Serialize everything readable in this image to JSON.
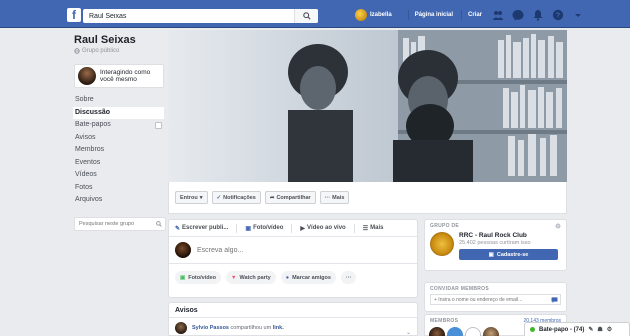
{
  "topbar": {
    "logo": "f",
    "search_value": "Raul Seixas",
    "user_name": "Izabella",
    "home_label": "Página inicial",
    "create_label": "Criar"
  },
  "group": {
    "name": "Raul Seixas",
    "type": "Grupo público",
    "interact_label": "Interagindo como você mesmo"
  },
  "sidebar": {
    "items": [
      {
        "label": "Sobre"
      },
      {
        "label": "Discussão"
      },
      {
        "label": "Bate-papos"
      },
      {
        "label": "Avisos"
      },
      {
        "label": "Membros"
      },
      {
        "label": "Eventos"
      },
      {
        "label": "Vídeos"
      },
      {
        "label": "Fotos"
      },
      {
        "label": "Arquivos"
      }
    ],
    "active_index": 1,
    "search_placeholder": "Pesquisar neste grupo"
  },
  "actions": {
    "joined": "Entrou",
    "notifications": "Notificações",
    "share": "Compartilhar",
    "more": "Mais"
  },
  "composer": {
    "tabs": [
      "Escrever publi...",
      "Foto/vídeo",
      "Vídeo ao vivo",
      "Mais"
    ],
    "placeholder": "Escreva algo...",
    "actions": [
      "Foto/vídeo",
      "Watch party",
      "Marcar amigos",
      "···"
    ]
  },
  "avisos": {
    "title": "Avisos",
    "post_author": "Sylvio Passos",
    "post_text": "compartilhou um",
    "post_link": "link."
  },
  "group_card": {
    "heading": "GRUPO DE",
    "page_name": "RRC - Raul Rock Club",
    "likes": "25.402 pessoas curtiram isso",
    "button": "Cadastre-se"
  },
  "invite": {
    "heading": "CONVIDAR MEMBROS",
    "placeholder": "+ Insira o nome ou endereço de email..."
  },
  "members": {
    "heading": "MEMBROS",
    "count": "20.143 membros"
  },
  "chat": {
    "label": "Bate-papo - (74)"
  },
  "colors": {
    "brand": "#4267b2",
    "background": "#e9ebee",
    "online": "#42b72a"
  }
}
